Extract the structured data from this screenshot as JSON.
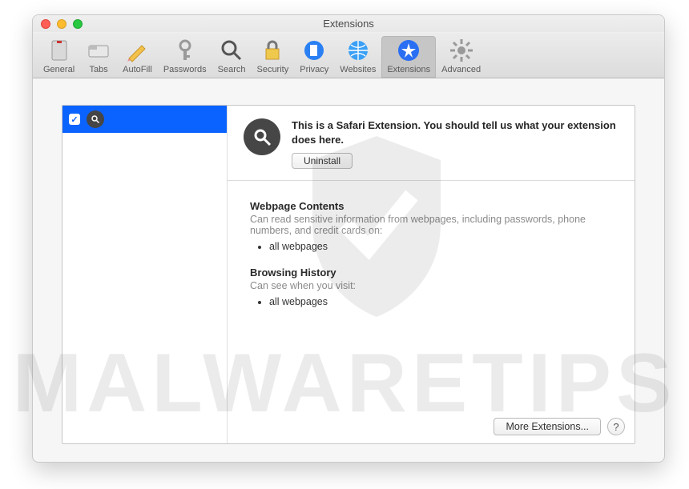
{
  "window": {
    "title": "Extensions"
  },
  "toolbar": {
    "items": [
      {
        "label": "General"
      },
      {
        "label": "Tabs"
      },
      {
        "label": "AutoFill"
      },
      {
        "label": "Passwords"
      },
      {
        "label": "Search"
      },
      {
        "label": "Security"
      },
      {
        "label": "Privacy"
      },
      {
        "label": "Websites"
      },
      {
        "label": "Extensions"
      },
      {
        "label": "Advanced"
      }
    ]
  },
  "sidebar": {
    "selected": {
      "checked": true
    }
  },
  "detail": {
    "headline": "This is a Safari Extension. You should tell us what your extension does here.",
    "uninstall_label": "Uninstall",
    "sections": [
      {
        "heading": "Webpage Contents",
        "sub": "Can read sensitive information from webpages, including passwords, phone numbers, and credit cards on:",
        "items": [
          "all webpages"
        ]
      },
      {
        "heading": "Browsing History",
        "sub": "Can see when you visit:",
        "items": [
          "all webpages"
        ]
      }
    ]
  },
  "footer": {
    "more_label": "More Extensions...",
    "help_label": "?"
  },
  "watermark": "MALWARETIPS"
}
